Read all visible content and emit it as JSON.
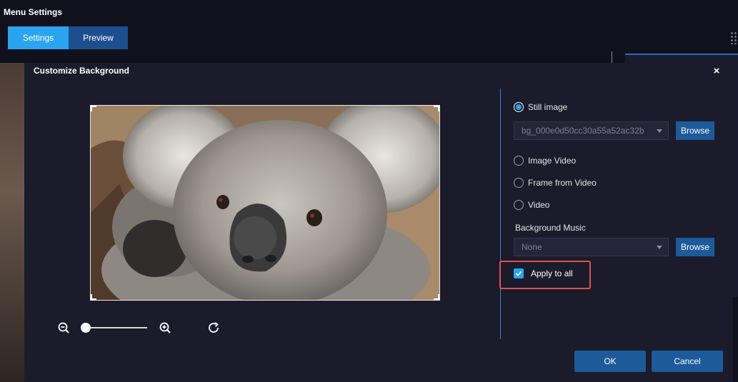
{
  "app": {
    "title": "Menu Settings"
  },
  "tabs": [
    {
      "label": "Settings",
      "active": true
    },
    {
      "label": "Preview",
      "active": false
    }
  ],
  "dialog": {
    "title": "Customize Background",
    "close_label": "×",
    "options": {
      "still_image": {
        "label": "Still image",
        "checked": true
      },
      "image_video": {
        "label": "Image Video",
        "checked": false
      },
      "frame_from_video": {
        "label": "Frame from Video",
        "checked": false
      },
      "video": {
        "label": "Video",
        "checked": false
      }
    },
    "image_select": {
      "value": "bg_000e0d50cc30a55a52ac32b"
    },
    "browse_label": "Browse",
    "music": {
      "label": "Background Music",
      "value": "None",
      "browse_label": "Browse"
    },
    "apply_to_all": {
      "label": "Apply to all",
      "checked": true
    },
    "ok_label": "OK",
    "cancel_label": "Cancel",
    "zoom_level": 0
  },
  "colors": {
    "accent": "#2aa4ee",
    "button": "#1d5a9a",
    "highlight": "#e0524a",
    "background": "#1b1b2b"
  }
}
